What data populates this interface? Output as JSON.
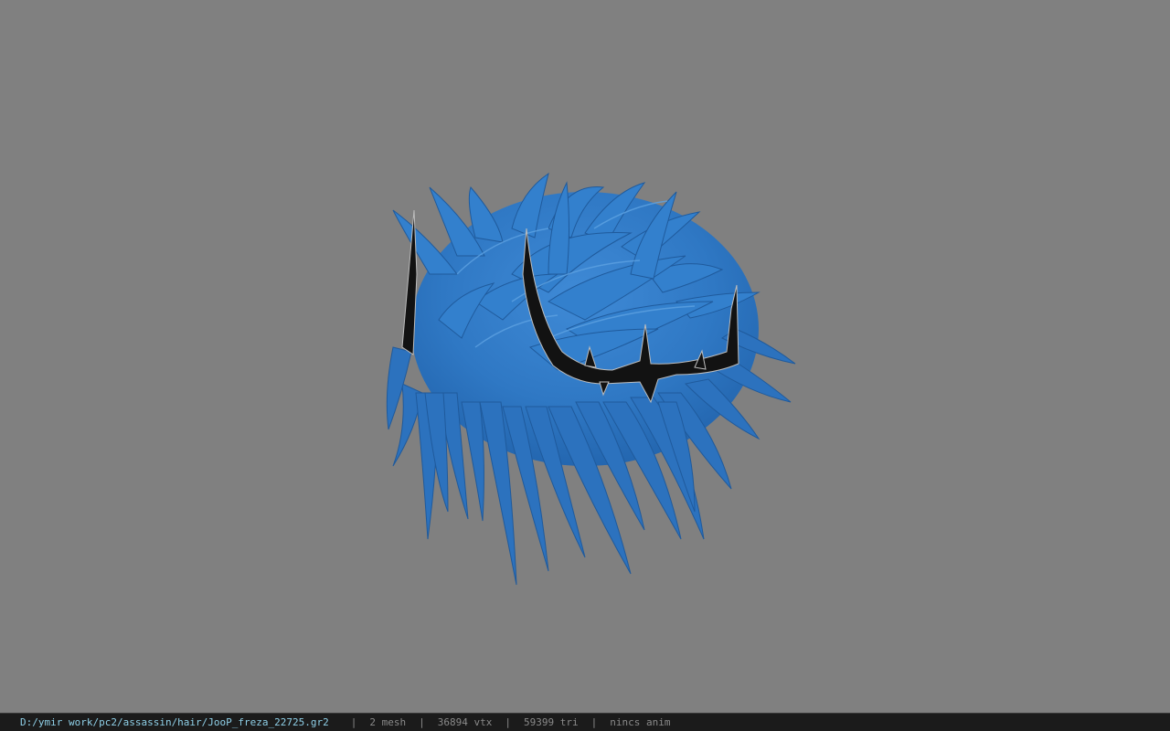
{
  "viewer": {
    "model_description": "blue spiky hair mesh with black thorn-crown accessory"
  },
  "status_bar": {
    "file_path": "D:/ymir work/pc2/assassin/hair/JooP_freza_22725.gr2",
    "separator": "|",
    "mesh_count": "2 mesh",
    "vertex_count": "36894 vtx",
    "triangle_count": "59399 tri",
    "anim_status": "nincs anim"
  },
  "colors": {
    "background": "#808080",
    "hair": "#2f78c4",
    "hair_shadow": "#1f5a9c",
    "hair_highlight": "#4a93db",
    "thorn": "#121212",
    "status_bar_bg": "#1b1b1b",
    "path_text": "#8fd0e8",
    "stat_text": "#8a8a8a"
  }
}
